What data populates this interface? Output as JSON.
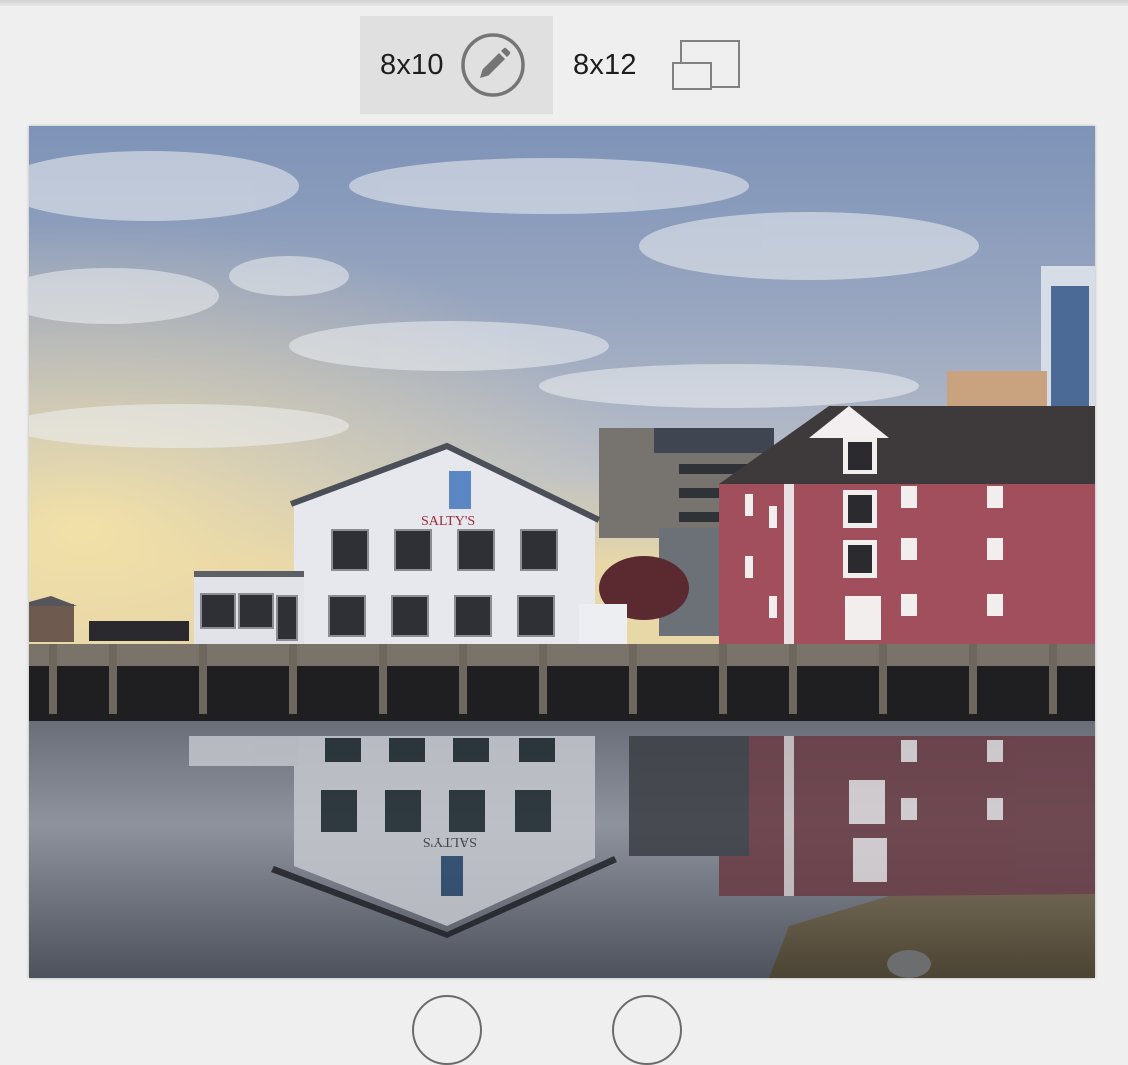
{
  "print_sizes": {
    "selected_label": "8x10",
    "alternate_label": "8x12"
  },
  "icons": {
    "edit": "pencil-circle-icon",
    "orientation": "rotate-orientation-icon",
    "bottom_controls": [
      "circle-control-icon",
      "circle-control-icon"
    ]
  },
  "photo": {
    "sign_text": "SALTY'S",
    "reflection_sign_text": "SALTY'S"
  },
  "colors": {
    "selected_option_bg": "#e0e0e0",
    "icon_stroke": "#757575",
    "page_bg": "#efefef"
  }
}
